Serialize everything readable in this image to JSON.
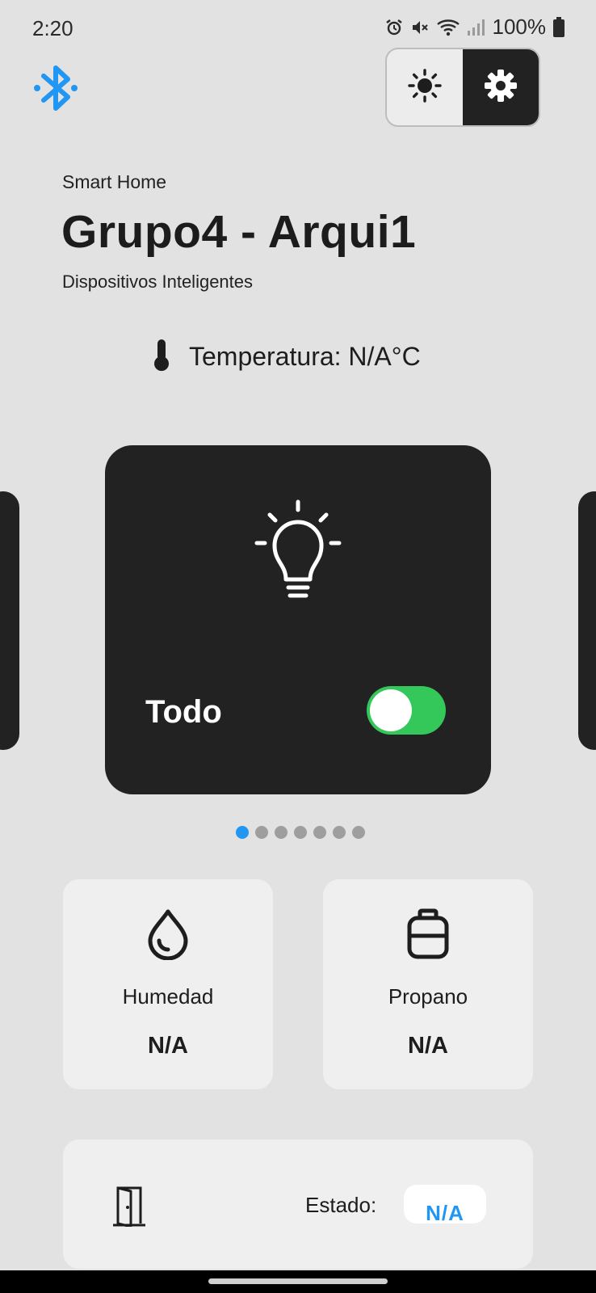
{
  "status_bar": {
    "time": "2:20",
    "battery": "100%",
    "icons": [
      "alarm-icon",
      "mute-icon",
      "wifi-icon",
      "signal-icon",
      "battery-icon"
    ]
  },
  "header": {
    "bluetooth_icon": "bluetooth-icon",
    "theme_options": [
      "sun-icon",
      "gear-icon"
    ],
    "active_theme_option": "gear-icon",
    "kicker": "Smart Home",
    "title": "Grupo4 - Arqui1",
    "subtitle": "Dispositivos Inteligentes"
  },
  "temperature": {
    "icon": "thermometer-icon",
    "text": "Temperatura: N/A°C"
  },
  "carousel": {
    "card": {
      "icon": "lightbulb-icon",
      "label": "Todo",
      "switch_on": true
    },
    "page_count": 7,
    "active_page": 0
  },
  "sensors": {
    "humedad": {
      "icon": "water-drop-icon",
      "label": "Humedad",
      "value": "N/A"
    },
    "propano": {
      "icon": "gas-tank-icon",
      "label": "Propano",
      "value": "N/A"
    }
  },
  "door": {
    "icon": "door-icon",
    "state_label": "Estado:",
    "state_value": "N/A"
  },
  "colors": {
    "background": "#e2e2e2",
    "card_dark": "#222222",
    "accent_blue": "#2196f3",
    "switch_green": "#34c759",
    "tile_light": "#efefef"
  }
}
